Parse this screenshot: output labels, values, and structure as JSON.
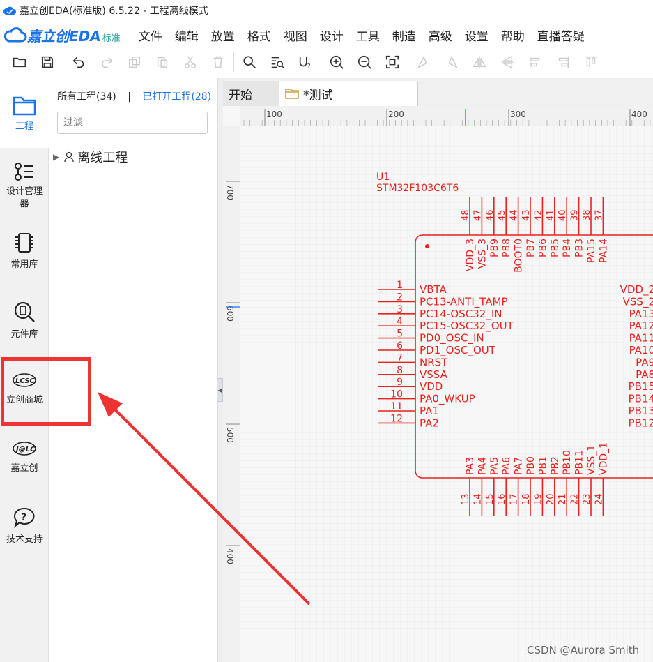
{
  "window": {
    "title": "嘉立创EDA(标准版) 6.5.22 - 工程离线模式"
  },
  "brand": {
    "logo": "嘉立创EDA",
    "edition": "标准"
  },
  "menu": [
    "文件",
    "编辑",
    "放置",
    "格式",
    "视图",
    "设计",
    "工具",
    "制造",
    "高级",
    "设置",
    "帮助",
    "直播答疑"
  ],
  "leftbar": {
    "items": [
      {
        "label": "工程",
        "icon": "folder-icon"
      },
      {
        "label": "设计管理器",
        "icon": "design-manager-icon"
      },
      {
        "label": "常用库",
        "icon": "chip-icon"
      },
      {
        "label": "元件库",
        "icon": "component-search-icon"
      },
      {
        "label": "立创商城",
        "icon": "lcsc-icon",
        "logo_text": "LCSC"
      },
      {
        "label": "嘉立创",
        "icon": "jlc-icon",
        "logo_text": "J@LC"
      },
      {
        "label": "技术支持",
        "icon": "help-icon"
      }
    ]
  },
  "panel": {
    "all_projects": "所有工程(34)",
    "separator": "|",
    "opened_projects": "已打开工程(28)",
    "filter_placeholder": "过滤",
    "tree": {
      "label": "离线工程"
    }
  },
  "doc_tabs": [
    {
      "label": "开始"
    },
    {
      "label": "*测试"
    }
  ],
  "ruler": {
    "top": [
      "100",
      "200",
      "300",
      "400"
    ],
    "left": [
      "700",
      "600",
      "500",
      "400"
    ]
  },
  "schematic": {
    "designator": "U1",
    "part": "STM32F103C6T6",
    "left_pins": [
      {
        "num": "1",
        "name": "VBTA"
      },
      {
        "num": "2",
        "name": "PC13-ANTI_TAMP"
      },
      {
        "num": "3",
        "name": "PC14-OSC32_IN"
      },
      {
        "num": "4",
        "name": "PC15-OSC32_OUT"
      },
      {
        "num": "5",
        "name": "PD0_OSC_IN"
      },
      {
        "num": "6",
        "name": "PD1_OSC_OUT"
      },
      {
        "num": "7",
        "name": "NRST"
      },
      {
        "num": "8",
        "name": "VSSA"
      },
      {
        "num": "9",
        "name": "VDD"
      },
      {
        "num": "10",
        "name": "PA0_WKUP"
      },
      {
        "num": "11",
        "name": "PA1"
      },
      {
        "num": "12",
        "name": "PA2"
      }
    ],
    "top_pins": [
      {
        "num": "48",
        "name": "VDD_3"
      },
      {
        "num": "47",
        "name": "VSS_3"
      },
      {
        "num": "46",
        "name": "PB9"
      },
      {
        "num": "45",
        "name": "PB8"
      },
      {
        "num": "44",
        "name": "BOOT0"
      },
      {
        "num": "43",
        "name": "PB7"
      },
      {
        "num": "42",
        "name": "PB6"
      },
      {
        "num": "41",
        "name": "PB5"
      },
      {
        "num": "40",
        "name": "PB4"
      },
      {
        "num": "39",
        "name": "PB3"
      },
      {
        "num": "38",
        "name": "PA15"
      },
      {
        "num": "37",
        "name": "PA14"
      }
    ],
    "bottom_pins": [
      {
        "num": "13",
        "name": "PA3"
      },
      {
        "num": "14",
        "name": "PA4"
      },
      {
        "num": "15",
        "name": "PA5"
      },
      {
        "num": "16",
        "name": "PA6"
      },
      {
        "num": "17",
        "name": "PA7"
      },
      {
        "num": "18",
        "name": "PB0"
      },
      {
        "num": "19",
        "name": "PB1"
      },
      {
        "num": "20",
        "name": "PB2"
      },
      {
        "num": "21",
        "name": "PB10"
      },
      {
        "num": "22",
        "name": "PB11"
      },
      {
        "num": "23",
        "name": "VSS_1"
      },
      {
        "num": "24",
        "name": "VDD_1"
      }
    ],
    "right_pins": [
      "VDD_2",
      "VSS_2",
      "PA13",
      "PA12",
      "PA11",
      "PA10",
      "PA9",
      "PA8",
      "PB15",
      "PB14",
      "PB13",
      "PB12"
    ],
    "color": "#e8221f"
  },
  "annotation": {
    "color": "#ee3333"
  },
  "watermark": "CSDN @Aurora Smith"
}
